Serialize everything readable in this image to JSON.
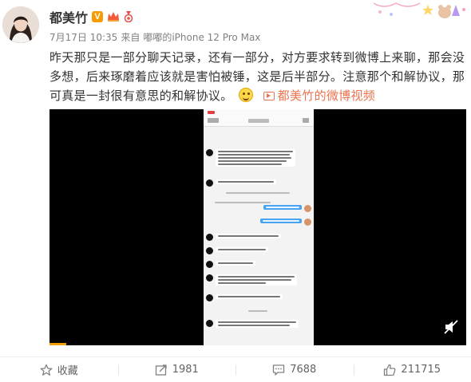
{
  "author": {
    "name": "都美竹",
    "verified_badge": "V"
  },
  "meta": {
    "date": "7月17日 10:35",
    "source_prefix": "来自",
    "source": "嘟嘟的iPhone 12 Pro Max"
  },
  "content": {
    "text": "昨天那只是一部分聊天记录，还有一部分，对方要求转到微博上来聊，那会没多想，后来琢磨着应该就是害怕被锤，这是后半部分。注意那个和解协议，那可真是一封很有意思的和解协议。",
    "video_link": "都美竹的微博视频"
  },
  "video": {
    "progress": 0.04
  },
  "actions": {
    "favorite_label": "收藏",
    "repost_count": "1981",
    "comment_count": "7688",
    "like_count": "211715"
  },
  "colors": {
    "accent": "#eb7350",
    "verified": "#f59b00",
    "text": "#333333",
    "muted": "#808080"
  }
}
